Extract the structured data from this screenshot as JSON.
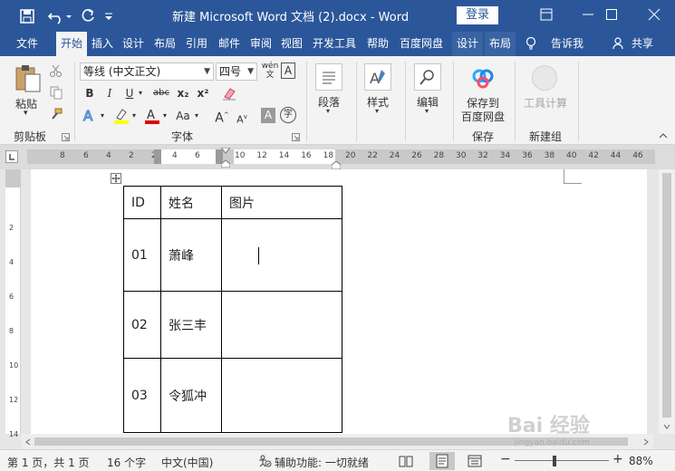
{
  "titlebar": {
    "title": "新建 Microsoft Word 文档 (2).docx  -  Word",
    "login": "登录",
    "bg": "#2b579a"
  },
  "tabs": [
    {
      "label": "文件"
    },
    {
      "label": "开始"
    },
    {
      "label": "插入"
    },
    {
      "label": "设计"
    },
    {
      "label": "布局"
    },
    {
      "label": "引用"
    },
    {
      "label": "邮件"
    },
    {
      "label": "审阅"
    },
    {
      "label": "视图"
    },
    {
      "label": "开发工具"
    },
    {
      "label": "帮助"
    },
    {
      "label": "百度网盘"
    },
    {
      "label": "设计"
    },
    {
      "label": "布局"
    },
    {
      "label": "告诉我"
    },
    {
      "label": "共享"
    }
  ],
  "ribbon": {
    "paste": "粘贴",
    "clipboard": "剪贴板",
    "font_name": "等线 (中文正文)",
    "font_size": "四号",
    "phonetic": "wén",
    "font_group": "字体",
    "paragraph": "段落",
    "styles": "样式",
    "edit": "编辑",
    "save_baidu": "保存到\n百度网盘",
    "save_baidu_1": "保存到",
    "save_baidu_2": "百度网盘",
    "save_group": "保存",
    "tool_calc": "工具计算",
    "new_group": "新建组",
    "bold": "B",
    "italic": "I",
    "underline": "U",
    "strike": "abc",
    "sub": "x₂",
    "sup": "x²",
    "aa": "Aa",
    "grow": "A",
    "shrink": "A",
    "boxed": "A",
    "circle": "字"
  },
  "ruler": {
    "left_nums": [
      "8",
      "6",
      "4",
      "2",
      "2",
      "4",
      "6"
    ],
    "right_nums": [
      "10",
      "12",
      "14",
      "16",
      "18",
      "20",
      "22",
      "24",
      "26",
      "28",
      "30",
      "32",
      "34",
      "36",
      "38",
      "40",
      "42",
      "44",
      "46"
    ],
    "v_nums": [
      "2",
      "4",
      "6",
      "8",
      "10",
      "12",
      "14"
    ]
  },
  "table": {
    "rows": [
      [
        "ID",
        "姓名",
        "图片"
      ],
      [
        "01",
        "萧峰",
        ""
      ],
      [
        "02",
        "张三丰",
        ""
      ],
      [
        "03",
        "令狐冲",
        ""
      ]
    ]
  },
  "status": {
    "page": "第 1 页，共 1 页",
    "words": "16 个字",
    "lang": "中文(中国)",
    "access": "辅助功能: 一切就绪",
    "zoom": "88%"
  },
  "watermark": {
    "text": "Bai 经验",
    "url": "jingyan.baidu.com"
  }
}
